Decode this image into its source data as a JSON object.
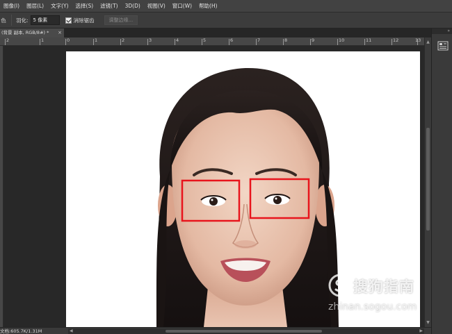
{
  "menubar": {
    "items": [
      {
        "label": "图像(I)"
      },
      {
        "label": "图层(L)"
      },
      {
        "label": "文字(Y)"
      },
      {
        "label": "选择(S)"
      },
      {
        "label": "滤镜(T)"
      },
      {
        "label": "3D(D)"
      },
      {
        "label": "视图(V)"
      },
      {
        "label": "窗口(W)"
      },
      {
        "label": "帮助(H)"
      }
    ]
  },
  "options": {
    "tool_glyph": "色",
    "feather_label": "羽化:",
    "feather_value": "5 像素",
    "antialias_label": "消除锯齿",
    "antialias_checked": true,
    "refine_edge_label": "调整边缘..."
  },
  "document_tab": {
    "title": "(背景 副本, RGB/8#) *",
    "close_glyph": "×"
  },
  "ruler": {
    "labels": [
      "2",
      "1",
      "0",
      "1",
      "2",
      "3",
      "4",
      "5",
      "6",
      "7",
      "8",
      "9",
      "10",
      "11",
      "12",
      "13"
    ]
  },
  "status": {
    "doc_info": "文档:605.7K/1.31M"
  },
  "watermark": {
    "brand": "搜狗指南",
    "url": "zhinan.sogou.com"
  },
  "selections": [
    {
      "name": "left-eye"
    },
    {
      "name": "right-eye"
    }
  ],
  "colors": {
    "selection_stroke": "#e8141c",
    "ui_dark": "#282828",
    "menubar": "#424242"
  }
}
